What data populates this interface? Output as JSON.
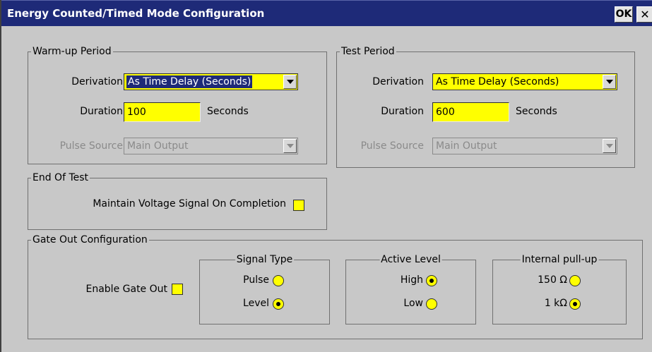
{
  "window": {
    "title": "Energy Counted/Timed Mode Configuration",
    "ok_label": "OK",
    "close_label": "✕"
  },
  "warmup": {
    "title": "Warm-up Period",
    "derivation_label": "Derivation",
    "derivation_value": "As Time Delay (Seconds)",
    "duration_label": "Duration",
    "duration_value": "100",
    "duration_unit": "Seconds",
    "pulse_source_label": "Pulse Source",
    "pulse_source_value": "Main Output"
  },
  "test": {
    "title": "Test Period",
    "derivation_label": "Derivation",
    "derivation_value": "As Time Delay (Seconds)",
    "duration_label": "Duration",
    "duration_value": "600",
    "duration_unit": "Seconds",
    "pulse_source_label": "Pulse Source",
    "pulse_source_value": "Main Output"
  },
  "end_of_test": {
    "title": "End Of Test",
    "maintain_label": "Maintain Voltage Signal On Completion",
    "maintain_checked": false
  },
  "gate_out": {
    "title": "Gate Out Configuration",
    "enable_label": "Enable Gate Out",
    "enable_checked": false,
    "signal_type": {
      "title": "Signal Type",
      "options": [
        "Pulse",
        "Level"
      ],
      "selected": "Level"
    },
    "active_level": {
      "title": "Active Level",
      "options": [
        "High",
        "Low"
      ],
      "selected": "High"
    },
    "pullup": {
      "title": "Internal pull-up",
      "options": [
        "150 Ω",
        "1 kΩ"
      ],
      "selected": "1 kΩ"
    }
  },
  "colors": {
    "title_bar": "#1e2a78",
    "field_highlight": "#ffff00",
    "window_bg": "#c8c8c8"
  }
}
